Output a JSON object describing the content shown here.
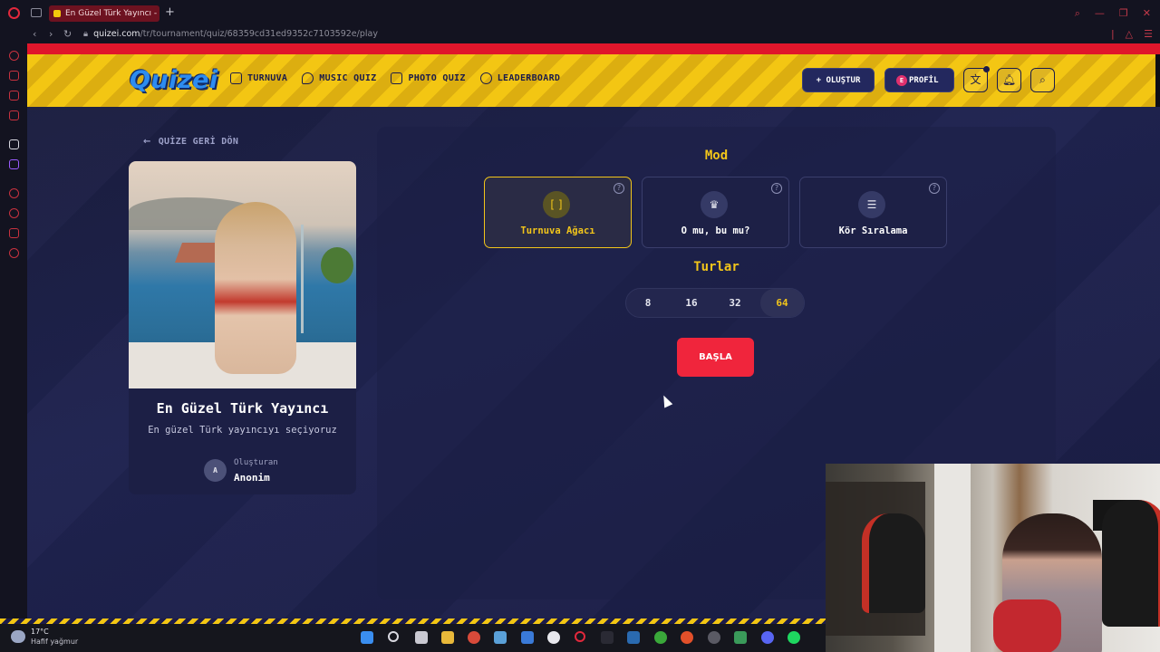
{
  "browser": {
    "tab_title": "En Güzel Türk Yayıncı - Quizei",
    "new_tab": "+",
    "url_host": "quizei.com",
    "url_path": "/tr/tournament/quiz/68359cd31ed9352c7103592e/play"
  },
  "header": {
    "logo": "Quizei",
    "nav": [
      {
        "label": "TURNUVA",
        "icon": "trophy-icon"
      },
      {
        "label": "MUSIC QUIZ",
        "icon": "music-note-icon"
      },
      {
        "label": "PHOTO QUIZ",
        "icon": "camera-icon"
      },
      {
        "label": "LEADERBOARD",
        "icon": "medal-icon"
      }
    ],
    "create_label": "+ OLUŞTUR",
    "profile_label": "PROFİL",
    "profile_initial": "E"
  },
  "sidebar_card": {
    "back_label": "QUİZE GERİ DÖN",
    "quiz_title": "En Güzel Türk Yayıncı",
    "quiz_description": "En güzel Türk yayıncıyı seçiyoruz",
    "author_initial": "A",
    "author_label": "Oluşturan",
    "author_name": "Anonim"
  },
  "mode_section": {
    "title": "Mod",
    "modes": [
      {
        "label": "Turnuva Ağacı",
        "icon": "bracket-icon",
        "selected": true
      },
      {
        "label": "O mu, bu mu?",
        "icon": "crown-icon",
        "selected": false
      },
      {
        "label": "Kör Sıralama",
        "icon": "list-icon",
        "selected": false
      }
    ]
  },
  "rounds_section": {
    "title": "Turlar",
    "options": [
      "8",
      "16",
      "32",
      "64"
    ],
    "selected": "64"
  },
  "start_label": "BAŞLA",
  "taskbar": {
    "temperature": "17°C",
    "condition": "Hafif yağmur"
  },
  "colors": {
    "accent_yellow": "#f2c51a",
    "start_red": "#f0253c",
    "panel_navy": "#1c1f45",
    "header_yellow": "#f3c613"
  }
}
